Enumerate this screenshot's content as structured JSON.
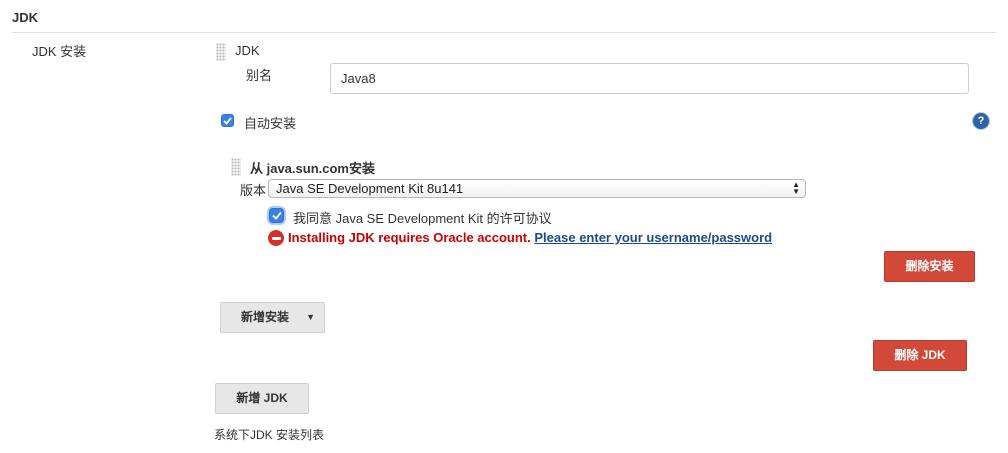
{
  "section": {
    "title": "JDK"
  },
  "row": {
    "label": "JDK 安装"
  },
  "jdk_entry": {
    "header": "JDK",
    "alias_label": "别名",
    "alias_value": "Java8",
    "auto_install_label": "自动安装",
    "help_icon": "question-icon",
    "installer": {
      "title": "从 java.sun.com安装",
      "version_label": "版本",
      "version_selected": "Java SE Development Kit 8u141",
      "agree_label": "我同意 Java SE Development Kit 的许可协议",
      "error_text": "Installing JDK requires Oracle account.",
      "error_link": "Please enter your username/password",
      "delete_installer_button": "删除安装"
    },
    "add_installer_button": "新增安装",
    "delete_jdk_button": "删除 JDK"
  },
  "add_jdk_button": "新增 JDK",
  "footer_text": "系统下JDK 安装列表",
  "colors": {
    "danger": "#d24939",
    "error_text": "#cc0000",
    "link": "#1e4a8a",
    "checkbox": "#3b82e4"
  }
}
